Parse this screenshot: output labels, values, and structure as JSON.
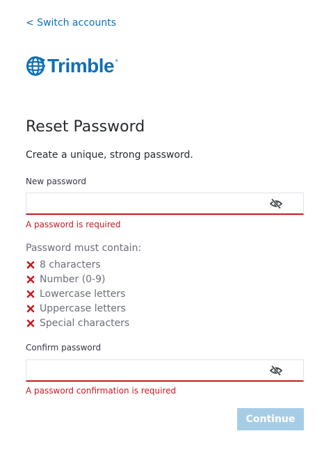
{
  "nav": {
    "switch_accounts": "< Switch accounts"
  },
  "brand": {
    "logo_text": "Trimble",
    "registered_mark": "®",
    "color": "#0e6fb8"
  },
  "form": {
    "title": "Reset Password",
    "subtitle": "Create a unique, strong password.",
    "new_password": {
      "label": "New password",
      "value": "",
      "error": "A password is required",
      "visibility_icon": "eye-slash-icon"
    },
    "requirements": {
      "heading": "Password must contain:",
      "icon": "x-mark-icon",
      "items": [
        "8 characters",
        "Number (0-9)",
        "Lowercase letters",
        "Uppercase letters",
        "Special characters"
      ]
    },
    "confirm_password": {
      "label": "Confirm password",
      "value": "",
      "error": "A password confirmation is required",
      "visibility_icon": "eye-slash-icon"
    },
    "continue_label": "Continue"
  },
  "colors": {
    "link": "#0e6fb8",
    "error": "#c81922",
    "button_disabled": "#a7cde6"
  }
}
